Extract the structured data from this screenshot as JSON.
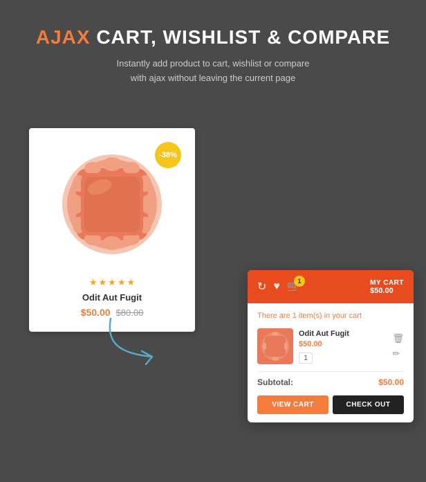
{
  "header": {
    "title_prefix": "AJAX",
    "title_rest": " CART, WISHLIST & COMPARE",
    "subtitle_line1": "Instantly add product to cart, wishlist or compare",
    "subtitle_line2": "with ajax without leaving the current page"
  },
  "product": {
    "discount_badge": "-38%",
    "stars": [
      "★",
      "★",
      "★",
      "★",
      "★"
    ],
    "name": "Odit Aut Fugit",
    "current_price": "$50.00",
    "original_price": "$80.00"
  },
  "cart_popup": {
    "my_cart_label": "MY CART",
    "my_cart_amount": "$50.00",
    "badge_count": "1",
    "info_text_prefix": "There are ",
    "info_text_items": "1 item(s)",
    "info_text_suffix": " in your cart",
    "item_name": "Odit Aut Fugit",
    "item_price": "$50.00",
    "item_qty": "1",
    "subtotal_label": "Subtotal:",
    "subtotal_amount": "$50.00",
    "view_cart_btn": "VIEW CART",
    "checkout_btn": "CHECK OUT"
  },
  "colors": {
    "accent_orange": "#f47c3c",
    "accent_red": "#e84c1e",
    "dark_bg": "#4a4a4a"
  }
}
